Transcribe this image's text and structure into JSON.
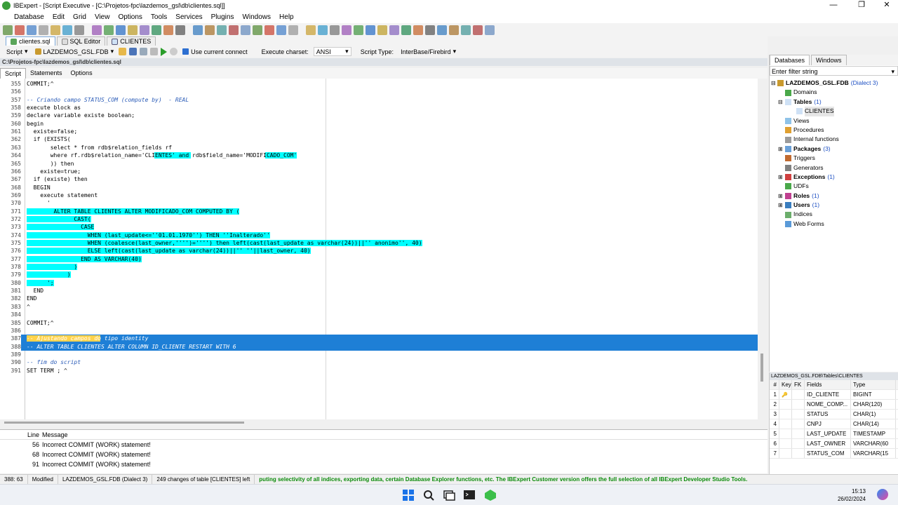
{
  "window": {
    "title": "IBExpert - [Script Executive - [C:\\Projetos-fpc\\lazdemos_gsl\\db\\clientes.sql]]",
    "min": "—",
    "max": "❐",
    "close": "✕"
  },
  "menu": [
    "Database",
    "Edit",
    "Grid",
    "View",
    "Options",
    "Tools",
    "Services",
    "Plugins",
    "Windows",
    "Help"
  ],
  "doc_tabs": [
    {
      "label": "clientes.sql",
      "icon": "script-icon"
    },
    {
      "label": "SQL Editor",
      "icon": "document-icon"
    },
    {
      "label": "CLIENTES",
      "icon": "table-icon"
    }
  ],
  "toolbar2": {
    "script_label": "Script",
    "database": "LAZDEMOS_GSL.FDB",
    "use_current_connect": "Use current connect",
    "charset_label": "Execute charset:",
    "charset_value": "ANSI",
    "script_type_label": "Script Type:",
    "script_type_value": "InterBase/Firebird"
  },
  "path": "C:\\Projetos-fpc\\lazdemos_gsl\\db\\clientes.sql",
  "sub_tabs": [
    "Script",
    "Statements",
    "Options"
  ],
  "code_lines": [
    {
      "n": "355",
      "t": "COMMIT;^"
    },
    {
      "n": "356",
      "t": ""
    },
    {
      "n": "357",
      "t": "-- Criando campo STATUS_COM (compute by)  - REAL",
      "c": true
    },
    {
      "n": "358",
      "t": "execute block as"
    },
    {
      "n": "359",
      "t": "declare variable existe boolean;"
    },
    {
      "n": "360",
      "t": "begin"
    },
    {
      "n": "361",
      "t": "  existe=false;"
    },
    {
      "n": "362",
      "t": "  if (EXISTS("
    },
    {
      "n": "363",
      "t": "       select * from rdb$relation_fields rf"
    },
    {
      "n": "364",
      "t": "       where rf.rdb$relation_name='CLIENTES' and rdb$field_name='MODIFICADO_COM'"
    },
    {
      "n": "365",
      "t": "       )) then"
    },
    {
      "n": "366",
      "t": "    existe=true;"
    },
    {
      "n": "367",
      "t": "  if (existe) then"
    },
    {
      "n": "368",
      "t": "  BEGIN"
    },
    {
      "n": "369",
      "t": "    execute statement"
    },
    {
      "n": "370",
      "t": "      '"
    },
    {
      "n": "371",
      "t": "        ALTER TABLE CLIENTES ALTER MODIFICADO_COM COMPUTED BY ("
    },
    {
      "n": "372",
      "t": "              CAST("
    },
    {
      "n": "373",
      "t": "                CASE"
    },
    {
      "n": "374",
      "t": "                  WHEN (last_update<=''01.01.1970'') THEN ''Inalterado''"
    },
    {
      "n": "375",
      "t": "                  WHEN (coalesce(last_owner,'''')='''') then left(cast(last_update as varchar(24))||'' anonimo'', 40)"
    },
    {
      "n": "376",
      "t": "                  ELSE left(cast(last_update as varchar(24))||'' ''||last_owner, 40)"
    },
    {
      "n": "377",
      "t": "                END AS VARCHAR(40)"
    },
    {
      "n": "378",
      "t": "              )"
    },
    {
      "n": "379",
      "t": "            )"
    },
    {
      "n": "380",
      "t": "      ';"
    },
    {
      "n": "381",
      "t": "  END"
    },
    {
      "n": "382",
      "t": "END"
    },
    {
      "n": "383",
      "t": "^"
    },
    {
      "n": "384",
      "t": ""
    },
    {
      "n": "385",
      "t": "COMMIT;^"
    },
    {
      "n": "386",
      "t": ""
    },
    {
      "n": "387",
      "t": "-- Ajustando campos do tipo identity",
      "c": true
    },
    {
      "n": "388",
      "t": "-- ALTER TABLE CLIENTES ALTER COLUMN ID_CLIENTE RESTART WITH 6",
      "c": true
    },
    {
      "n": "389",
      "t": ""
    },
    {
      "n": "390",
      "t": "-- fim do script",
      "c": true
    },
    {
      "n": "391",
      "t": "SET TERM ; ^"
    }
  ],
  "messages": {
    "headers": [
      "Line",
      "Message"
    ],
    "rows": [
      {
        "line": "56",
        "msg": "Incorrect COMMIT (WORK) statement!"
      },
      {
        "line": "68",
        "msg": "Incorrect COMMIT (WORK) statement!"
      },
      {
        "line": "91",
        "msg": "Incorrect COMMIT (WORK) statement!"
      }
    ]
  },
  "status": {
    "pos": "388:  63",
    "state": "Modified",
    "db": "LAZDEMOS_GSL.FDB (Dialect 3)",
    "changes": "249 changes of table [CLIENTES] left",
    "banner": "puting selectivity of all indices, exporting data, certain Database Explorer functions, etc. The IBExpert Customer version offers the full selection of all IBExpert Developer Studio Tools."
  },
  "right_tabs": [
    "Databases",
    "Windows"
  ],
  "filter_placeholder": "Enter filter string",
  "tree": {
    "root": "LAZDEMOS_GSL.FDB",
    "root_suffix": "(Dialect 3)",
    "nodes": [
      {
        "label": "Domains",
        "count": "",
        "bold": false
      },
      {
        "label": "Tables",
        "count": "(1)",
        "bold": true
      },
      {
        "label": "CLIENTES",
        "count": "",
        "bold": false,
        "child": true
      },
      {
        "label": "Views",
        "count": "",
        "bold": false
      },
      {
        "label": "Procedures",
        "count": "",
        "bold": false
      },
      {
        "label": "Internal functions",
        "count": "",
        "bold": false
      },
      {
        "label": "Packages",
        "count": "(3)",
        "bold": true
      },
      {
        "label": "Triggers",
        "count": "",
        "bold": false
      },
      {
        "label": "Generators",
        "count": "",
        "bold": false
      },
      {
        "label": "Exceptions",
        "count": "(1)",
        "bold": true
      },
      {
        "label": "UDFs",
        "count": "",
        "bold": false
      },
      {
        "label": "Roles",
        "count": "(1)",
        "bold": true
      },
      {
        "label": "Users",
        "count": "(1)",
        "bold": true
      },
      {
        "label": "Indices",
        "count": "",
        "bold": false
      },
      {
        "label": "Web Forms",
        "count": "",
        "bold": false
      }
    ]
  },
  "fields_panel": {
    "path": "LAZDEMOS_GSL.FDB\\Tables\\CLIENTES",
    "headers": [
      "#",
      "Key",
      "FK",
      "Fields",
      "Type"
    ],
    "rows": [
      [
        "1",
        "",
        "",
        "ID_CLIENTE",
        "BIGINT"
      ],
      [
        "2",
        "",
        "",
        "NOME_COMP...",
        "CHAR(120)"
      ],
      [
        "3",
        "",
        "",
        "STATUS",
        "CHAR(1)"
      ],
      [
        "4",
        "",
        "",
        "CNPJ",
        "CHAR(14)"
      ],
      [
        "5",
        "",
        "",
        "LAST_UPDATE",
        "TIMESTAMP"
      ],
      [
        "6",
        "",
        "",
        "LAST_OWNER",
        "VARCHAR(60"
      ],
      [
        "7",
        "",
        "",
        "STATUS_COM",
        "VARCHAR(15"
      ]
    ]
  },
  "clock": {
    "time": "15:13",
    "date": "26/02/2024"
  }
}
